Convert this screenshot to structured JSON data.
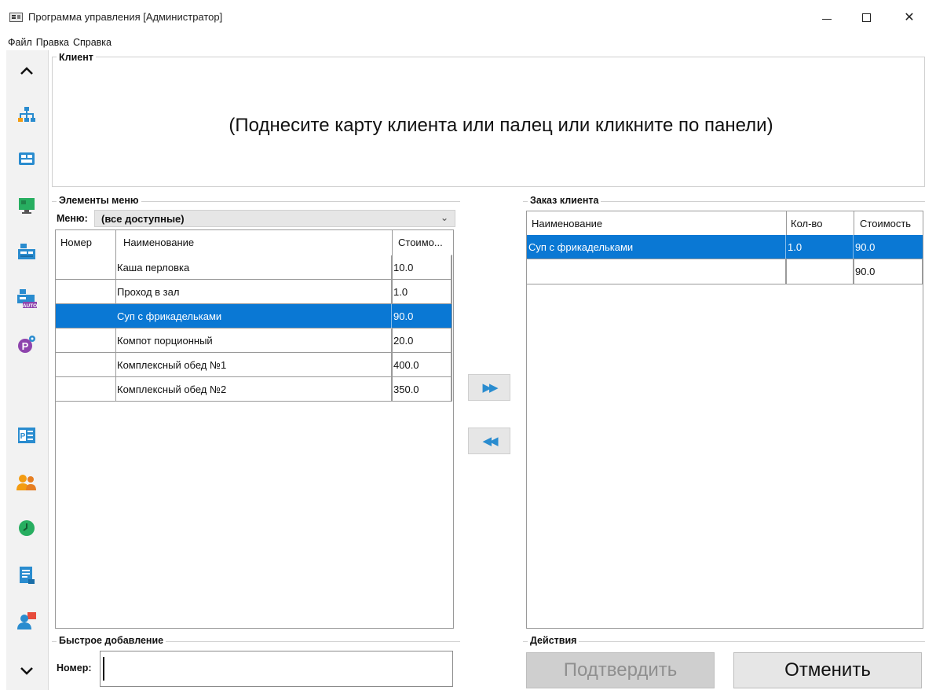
{
  "window": {
    "title": "Программа управления [Администратор]",
    "controls": {
      "minimize": "—",
      "maximize": "",
      "close": "✕"
    }
  },
  "menubar": [
    "Файл",
    "Правка",
    "Справка"
  ],
  "sidebar": {
    "up_icon": "chevron-up-icon",
    "down_icon": "chevron-down-icon",
    "items": [
      {
        "icon": "org-structure-icon"
      },
      {
        "icon": "menu-editor-icon"
      },
      {
        "icon": "terminal-icon"
      },
      {
        "icon": "cash-register-icon"
      },
      {
        "icon": "auto-register-icon"
      },
      {
        "icon": "settings-p-icon"
      },
      {
        "icon": "reports-p-icon"
      },
      {
        "icon": "users-icon"
      },
      {
        "icon": "clock-icon"
      },
      {
        "icon": "document-icon"
      },
      {
        "icon": "support-icon"
      }
    ]
  },
  "client": {
    "label": "Клиент",
    "message": "(Поднесите карту клиента или палец или кликните по панели)"
  },
  "menu_elements": {
    "label": "Элементы меню",
    "menu_label": "Меню:",
    "menu_value": "(все доступные)",
    "columns": [
      "Номер",
      "Наименование",
      "Стоимо..."
    ],
    "rows": [
      {
        "number": "",
        "name": "Каша перловка",
        "price": "10.0",
        "selected": false
      },
      {
        "number": "",
        "name": "Проход в зал",
        "price": "1.0",
        "selected": false
      },
      {
        "number": "",
        "name": "Суп с фрикадельками",
        "price": "90.0",
        "selected": true
      },
      {
        "number": "",
        "name": "Компот порционный",
        "price": "20.0",
        "selected": false
      },
      {
        "number": "",
        "name": "Комплексный обед №1",
        "price": "400.0",
        "selected": false
      },
      {
        "number": "",
        "name": "Комплексный обед №2",
        "price": "350.0",
        "selected": false
      }
    ]
  },
  "transfer": {
    "add": "▶▶",
    "remove": "◀◀"
  },
  "order": {
    "label": "Заказ клиента",
    "columns": [
      "Наименование",
      "Кол-во",
      "Стоимость"
    ],
    "rows": [
      {
        "name": "Суп с фрикадельками",
        "qty": "1.0",
        "price": "90.0",
        "selected": true
      },
      {
        "name": "",
        "qty": "",
        "price": "90.0",
        "selected": false
      }
    ]
  },
  "quick_add": {
    "label": "Быстрое добавление",
    "number_label": "Номер:",
    "number_value": ""
  },
  "actions": {
    "label": "Действия",
    "confirm": "Подтвердить",
    "cancel": "Отменить"
  },
  "colors": {
    "selection": "#0a78d4",
    "icon_blue": "#2a8ccf",
    "disabled_button": "#cfcfcf"
  }
}
